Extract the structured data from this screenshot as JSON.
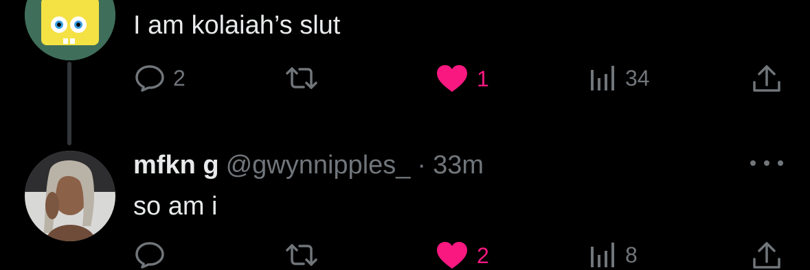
{
  "thread": {
    "tweets": [
      {
        "avatar": "spongebob-avatar",
        "text": "I am kolaiah’s slut",
        "actions": {
          "reply_count": "2",
          "retweet_count": "",
          "like_count": "1",
          "view_count": "34",
          "liked": true
        }
      },
      {
        "avatar": "user-photo-avatar",
        "display_name": "mfkn g",
        "handle": "@gwynnipples_",
        "separator": "·",
        "time": "33m",
        "text": "so am i",
        "actions": {
          "reply_count": "",
          "retweet_count": "",
          "like_count": "2",
          "view_count": "8",
          "liked": true
        }
      }
    ]
  },
  "colors": {
    "background": "#000000",
    "text_primary": "#e7e9ea",
    "text_secondary": "#71767b",
    "like_pink": "#f91880",
    "thread_line": "#333639"
  },
  "icons": [
    "reply-icon",
    "retweet-icon",
    "heart-icon",
    "views-icon",
    "share-icon",
    "more-icon"
  ]
}
